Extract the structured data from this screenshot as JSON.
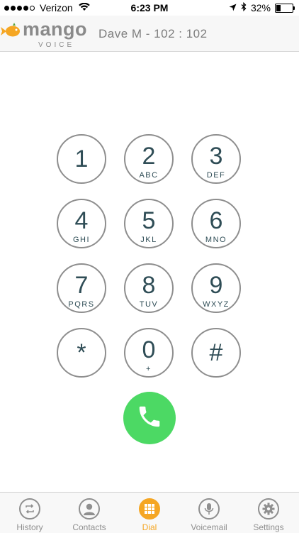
{
  "status_bar": {
    "carrier": "Verizon",
    "time": "6:23 PM",
    "battery_percent": "32%",
    "battery_level": 0.32,
    "signal_bars": 4
  },
  "header": {
    "logo_word": "mango",
    "logo_sub": "VOICE",
    "user_line": "Dave M - 102 : 102"
  },
  "keypad": {
    "keys": [
      {
        "digit": "1",
        "letters": ""
      },
      {
        "digit": "2",
        "letters": "ABC"
      },
      {
        "digit": "3",
        "letters": "DEF"
      },
      {
        "digit": "4",
        "letters": "GHI"
      },
      {
        "digit": "5",
        "letters": "JKL"
      },
      {
        "digit": "6",
        "letters": "MNO"
      },
      {
        "digit": "7",
        "letters": "PQRS"
      },
      {
        "digit": "8",
        "letters": "TUV"
      },
      {
        "digit": "9",
        "letters": "WXYZ"
      },
      {
        "digit": "*",
        "letters": ""
      },
      {
        "digit": "0",
        "letters": "+"
      },
      {
        "digit": "#",
        "letters": ""
      }
    ]
  },
  "tabs": [
    {
      "label": "History",
      "icon": "history-icon",
      "active": false
    },
    {
      "label": "Contacts",
      "icon": "contacts-icon",
      "active": false
    },
    {
      "label": "Dial",
      "icon": "dialpad-icon",
      "active": true
    },
    {
      "label": "Voicemail",
      "icon": "voicemail-icon",
      "active": false
    },
    {
      "label": "Settings",
      "icon": "settings-icon",
      "active": false
    }
  ],
  "colors": {
    "accent": "#f5a623",
    "call_green": "#4cd964",
    "key_text": "#2f4d56",
    "key_border": "#8e8e8e"
  }
}
